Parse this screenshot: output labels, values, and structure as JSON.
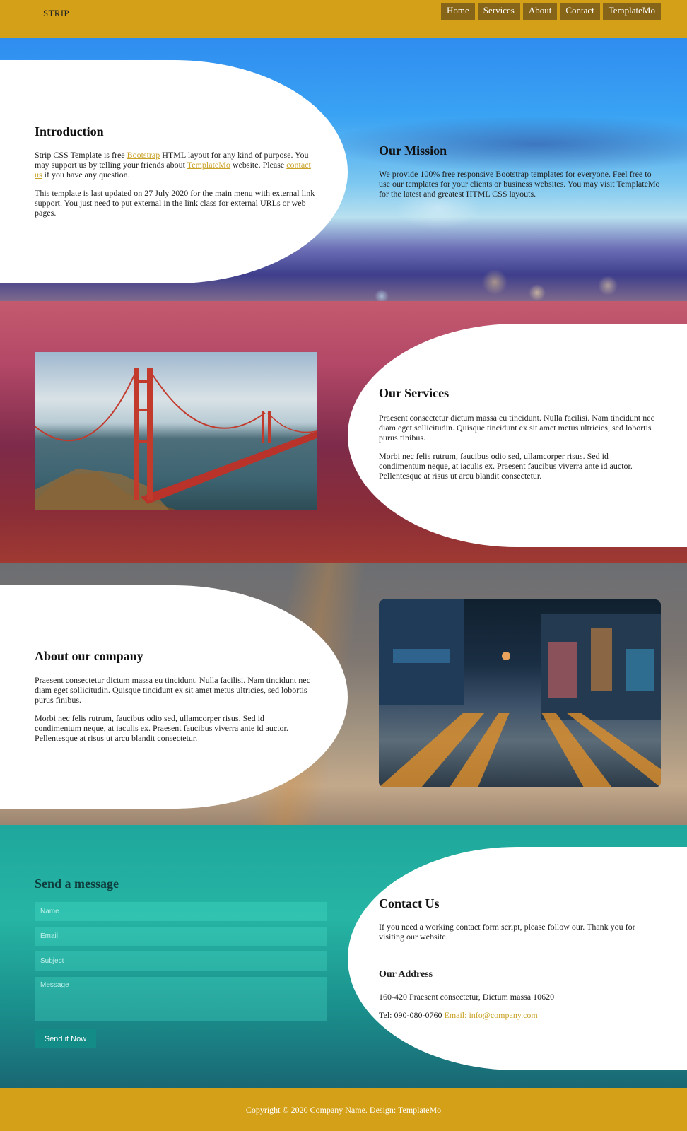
{
  "header": {
    "brand": "STRIP",
    "nav": [
      "Home",
      "Services",
      "About",
      "Contact",
      "TemplateMo"
    ]
  },
  "intro": {
    "title": "Introduction",
    "p1_a": "Strip CSS Template is free ",
    "p1_link1": "Bootstrap",
    "p1_b": " HTML layout for any kind of purpose. You may support us by telling your friends about ",
    "p1_link2": "TemplateMo",
    "p1_c": " website. Please ",
    "p1_link3": "contact us",
    "p1_d": " if you have any question.",
    "p2": "This template is last updated on 27 July 2020 for the main menu with external link support. You just need to put external in the link class for external URLs or web pages."
  },
  "mission": {
    "title": "Our Mission",
    "text": "We provide 100% free responsive Bootstrap templates for everyone. Feel free to use our templates for your clients or business websites. You may visit TemplateMo for the latest and greatest HTML CSS layouts."
  },
  "services": {
    "title": "Our Services",
    "p1": "Praesent consectetur dictum massa eu tincidunt. Nulla facilisi. Nam tincidunt nec diam eget sollicitudin. Quisque tincidunt ex sit amet metus ultricies, sed lobortis purus finibus.",
    "p2": "Morbi nec felis rutrum, faucibus odio sed, ullamcorper risus. Sed id condimentum neque, at iaculis ex. Praesent faucibus viverra ante id auctor. Pellentesque at risus ut arcu blandit consectetur."
  },
  "about": {
    "title": "About our company",
    "p1": "Praesent consectetur dictum massa eu tincidunt. Nulla facilisi. Nam tincidunt nec diam eget sollicitudin. Quisque tincidunt ex sit amet metus ultricies, sed lobortis purus finibus.",
    "p2": "Morbi nec felis rutrum, faucibus odio sed, ullamcorper risus. Sed id condimentum neque, at iaculis ex. Praesent faucibus viverra ante id auctor. Pellentesque at risus ut arcu blandit consectetur."
  },
  "form": {
    "title": "Send a message",
    "name_placeholder": "Name",
    "email_placeholder": "Email",
    "subject_placeholder": "Subject",
    "message_placeholder": "Message",
    "button": "Send it Now"
  },
  "contact": {
    "title": "Contact Us",
    "text": "If you need a working contact form script, please follow our. Thank you for visiting our website.",
    "address_title": "Our Address",
    "address": "160-420 Praesent consectetur, Dictum massa 10620",
    "tel": "Tel: 090-080-0760 ",
    "email": "Email: info@company.com"
  },
  "footer": {
    "copyright": "Copyright © 2020 Company Name. Design: TemplateMo"
  }
}
